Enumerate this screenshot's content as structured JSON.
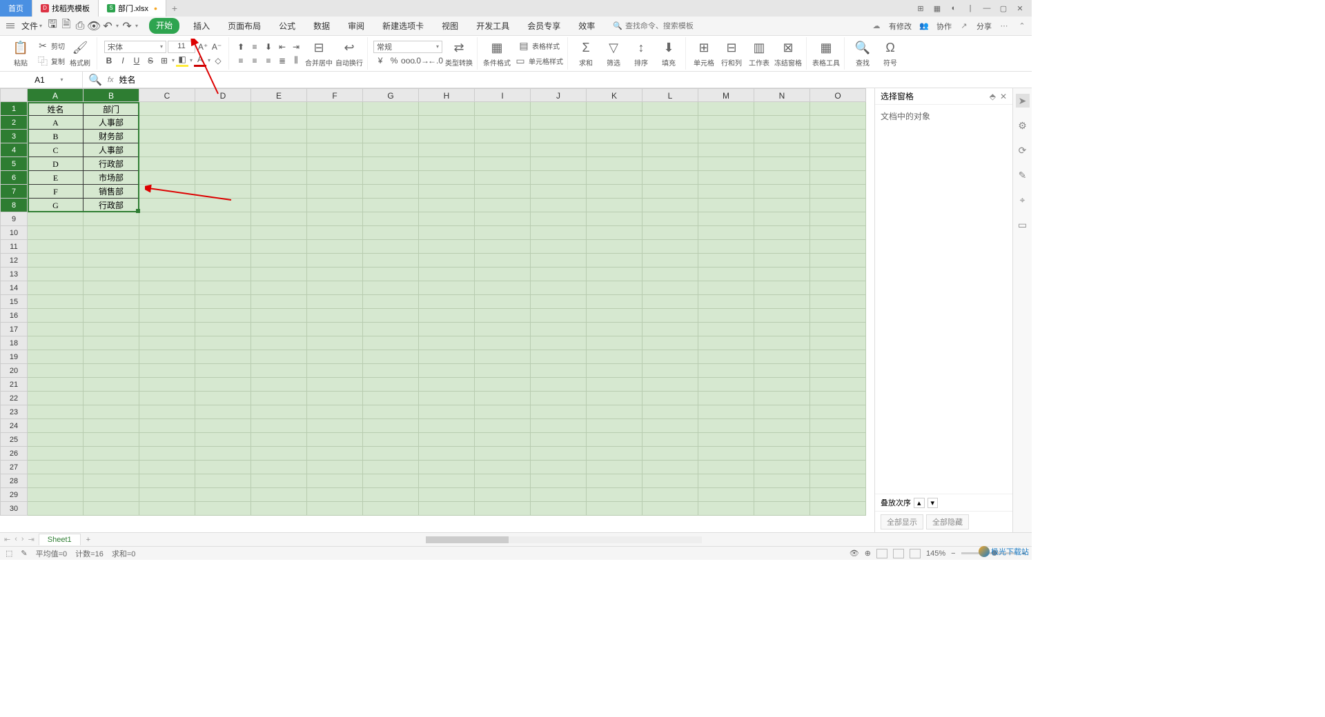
{
  "titlebar": {
    "home_tab": "首页",
    "template_tab": "找稻壳模板",
    "file_tab": "部门.xlsx"
  },
  "quickbar": {
    "file_menu": "文件"
  },
  "ribbon_tabs": [
    "开始",
    "插入",
    "页面布局",
    "公式",
    "数据",
    "审阅",
    "新建选项卡",
    "视图",
    "开发工具",
    "会员专享",
    "效率"
  ],
  "search": {
    "placeholder": "查找命令、搜索模板"
  },
  "qb_right": {
    "changes": "有修改",
    "collab": "协作",
    "share": "分享"
  },
  "toolbar": {
    "paste": "粘贴",
    "cut": "剪切",
    "copy": "复制",
    "format_painter": "格式刷",
    "font_name": "宋体",
    "font_size": "11",
    "merge": "合并居中",
    "wrap": "自动换行",
    "number_format": "常规",
    "type_convert": "类型转换",
    "cond_format": "条件格式",
    "table_style": "表格样式",
    "cell_style": "单元格样式",
    "sum": "求和",
    "filter": "筛选",
    "sort": "排序",
    "fill": "填充",
    "cells": "单元格",
    "rows_cols": "行和列",
    "worksheet": "工作表",
    "freeze": "冻结窗格",
    "table_tool": "表格工具",
    "find": "查找",
    "symbol": "符号"
  },
  "namebox": "A1",
  "formula": "姓名",
  "columns": [
    "A",
    "B",
    "C",
    "D",
    "E",
    "F",
    "G",
    "H",
    "I",
    "J",
    "K",
    "L",
    "M",
    "N",
    "O"
  ],
  "row_count": 30,
  "table": {
    "headers": [
      "姓名",
      "部门"
    ],
    "rows": [
      [
        "A",
        "人事部"
      ],
      [
        "B",
        "财务部"
      ],
      [
        "C",
        "人事部"
      ],
      [
        "D",
        "行政部"
      ],
      [
        "E",
        "市场部"
      ],
      [
        "F",
        "销售部"
      ],
      [
        "G",
        "行政部"
      ]
    ]
  },
  "panel": {
    "title": "选择窗格",
    "body": "文档中的对象",
    "order": "叠放次序",
    "show_all": "全部显示",
    "hide_all": "全部隐藏"
  },
  "sheet": {
    "name": "Sheet1"
  },
  "status": {
    "avg": "平均值=0",
    "count": "计数=16",
    "sum": "求和=0",
    "zoom": "145%"
  },
  "watermark": "极光下载站"
}
